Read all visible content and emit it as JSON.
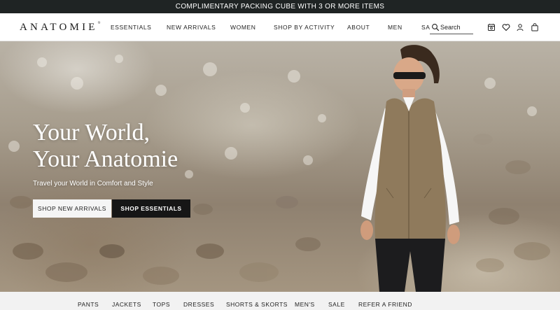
{
  "promo": {
    "text": "COMPLIMENTARY PACKING CUBE WITH 3 OR MORE ITEMS"
  },
  "header": {
    "logo": "ANATOMIE",
    "logo_mark": "®",
    "nav": [
      "ESSENTIALS",
      "NEW ARRIVALS",
      "WOMEN",
      "SHOP BY ACTIVITY",
      "ABOUT",
      "MEN",
      "SALE"
    ],
    "search_placeholder": "Search",
    "icons": [
      "catalog-icon",
      "heart-icon",
      "user-icon",
      "bag-icon"
    ]
  },
  "hero": {
    "title_line1": "Your World,",
    "title_line2": "Your Anatomie",
    "subtitle": "Travel your World in Comfort and Style",
    "primary_button": "SHOP NEW ARRIVALS",
    "secondary_button": "SHOP ESSENTIALS"
  },
  "category_bar": [
    "PANTS",
    "JACKETS",
    "TOPS",
    "DRESSES",
    "SHORTS & SKORTS",
    "MEN'S",
    "SALE",
    "REFER A FRIEND"
  ],
  "colors": {
    "promo_bg": "#1f2424",
    "button_dark": "#161616",
    "button_light": "#f5f5f5"
  }
}
